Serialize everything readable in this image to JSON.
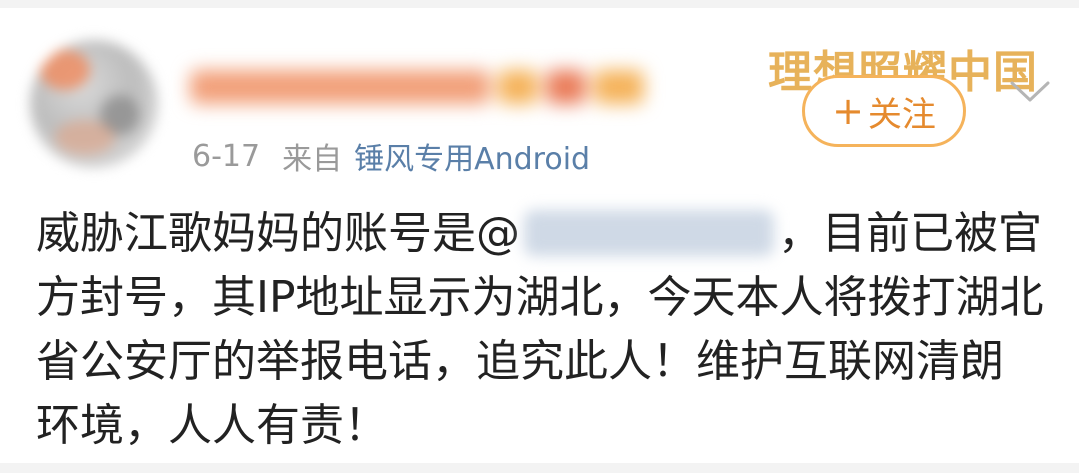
{
  "post": {
    "meta": {
      "date": "6-17",
      "from_label": "来自",
      "device": "锤风专用Android"
    },
    "watermark": "理想照耀中国",
    "follow_button": {
      "plus": "+",
      "label": "关注"
    },
    "body": {
      "before_mention": "威胁江歌妈妈的账号是@",
      "after_mention": "，目前已被官方封号，其IP地址显示为湖北，今天本人将拨打湖北省公安厅的举报电话，追究此人！维护互联网清朗环境，人人有责！"
    },
    "icons": {
      "more": "chevron-down-icon"
    },
    "colors": {
      "accent": "#e58a2e",
      "follow_border": "#f5b35b",
      "meta_text": "#9a9a9a",
      "device_link": "#5a7fa8",
      "body_text": "#222222"
    }
  }
}
